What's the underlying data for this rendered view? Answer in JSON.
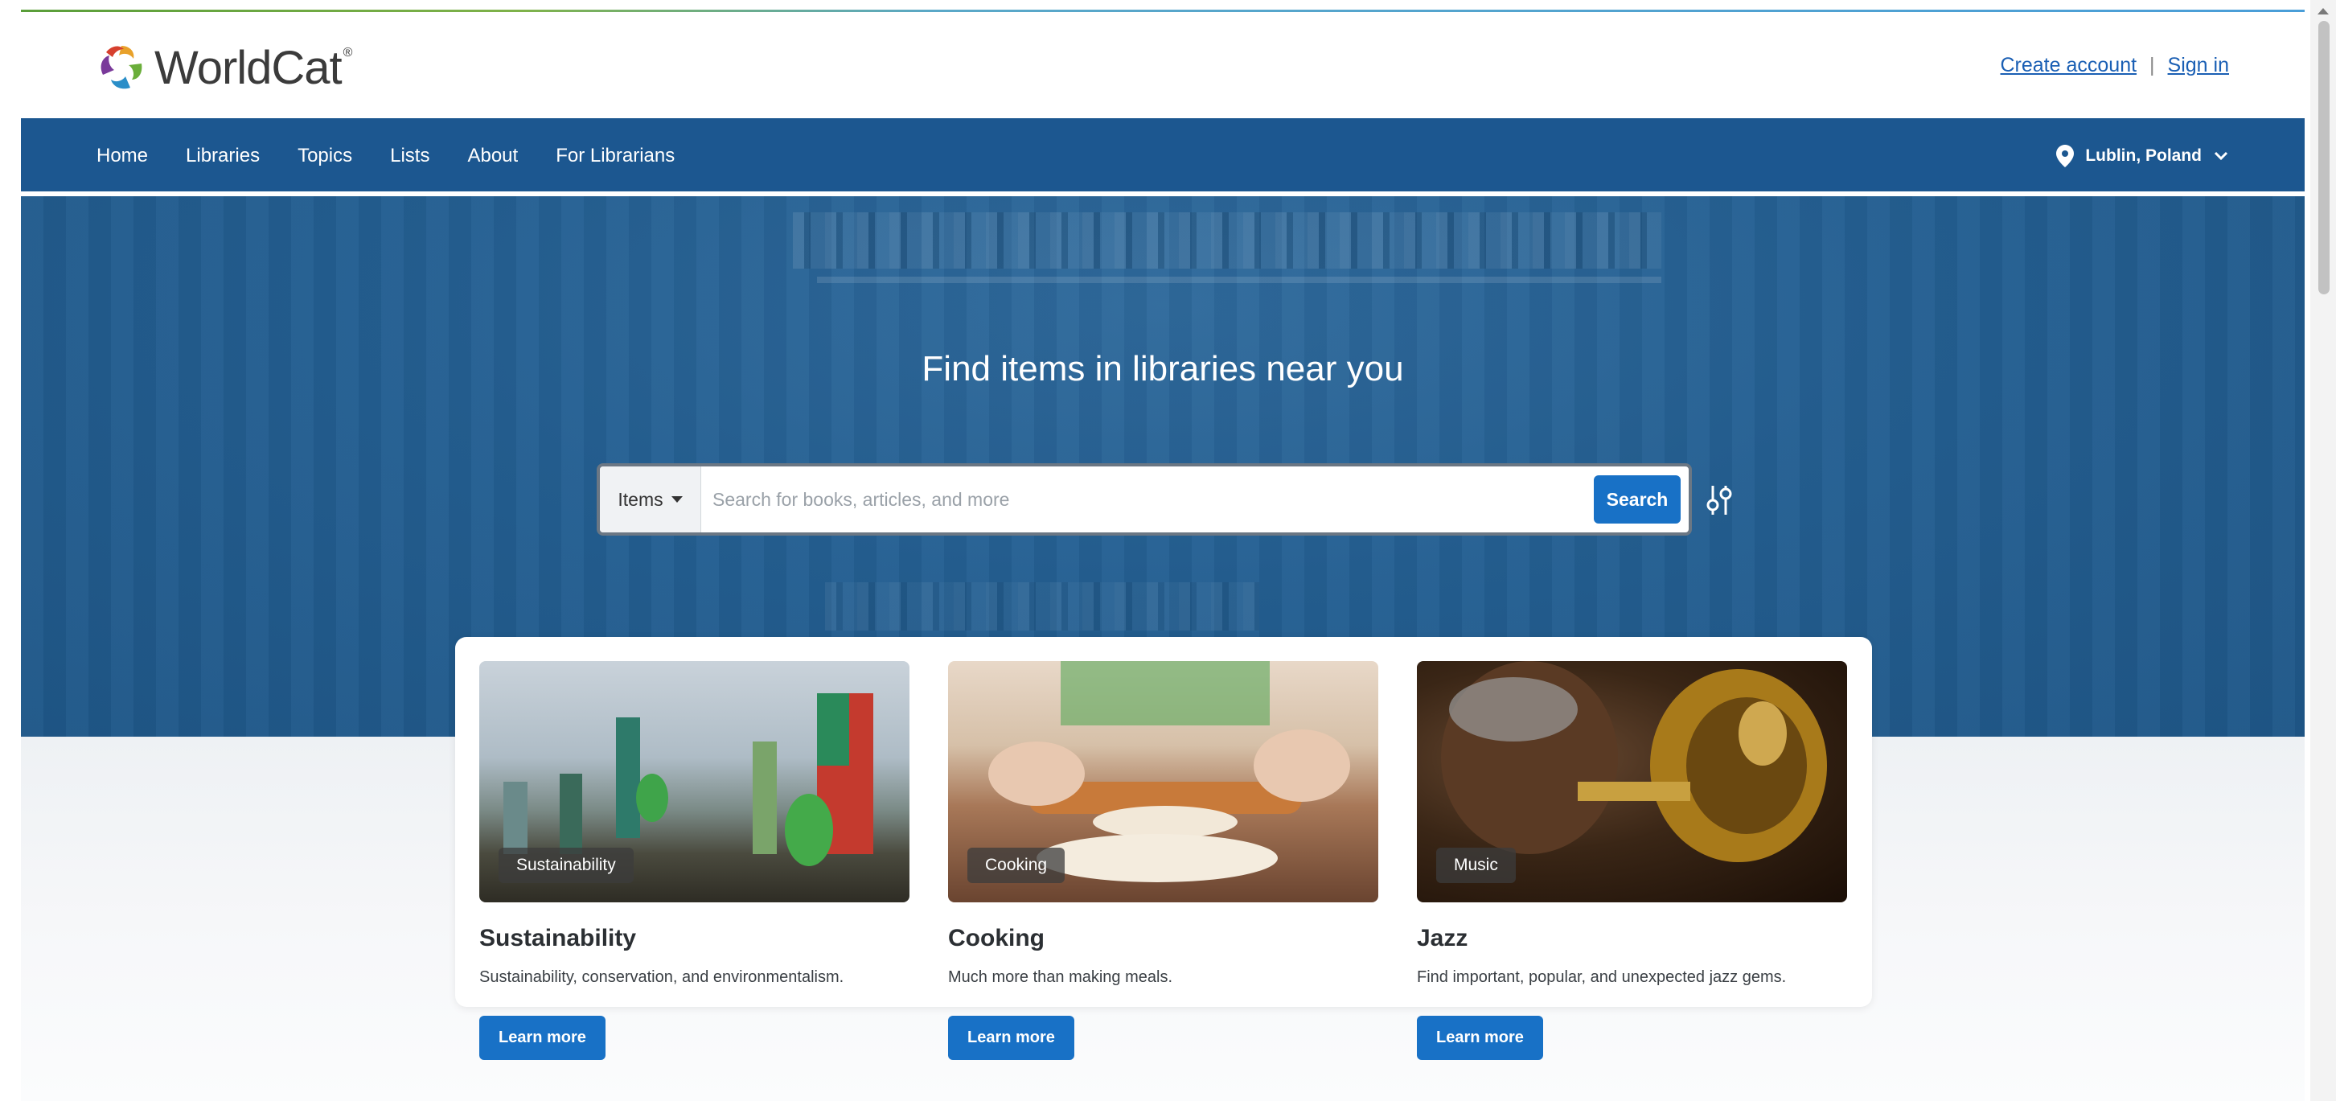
{
  "brand": {
    "name": "WorldCat",
    "mark": "®"
  },
  "account": {
    "create": "Create account",
    "separator": "|",
    "signin": "Sign in"
  },
  "nav": {
    "items": [
      "Home",
      "Libraries",
      "Topics",
      "Lists",
      "About",
      "For Librarians"
    ],
    "location": "Lublin, Poland"
  },
  "hero": {
    "title": "Find items in libraries near you"
  },
  "search": {
    "type": "Items",
    "placeholder": "Search for books, articles, and more",
    "button": "Search"
  },
  "cards": [
    {
      "tag": "Sustainability",
      "title": "Sustainability",
      "desc": "Sustainability, conservation, and environmentalism.",
      "button": "Learn more"
    },
    {
      "tag": "Cooking",
      "title": "Cooking",
      "desc": "Much more than making meals.",
      "button": "Learn more"
    },
    {
      "tag": "Music",
      "title": "Jazz",
      "desc": "Find important, popular, and unexpected jazz gems.",
      "button": "Learn more"
    }
  ],
  "colors": {
    "nav": "#1c5790",
    "accent": "#1871c6",
    "link": "#1a5fb4"
  },
  "icons": {
    "location": "map-pin-icon",
    "chevron": "chevron-down-icon",
    "caret": "caret-down-icon",
    "advanced": "advanced-search-icon"
  }
}
